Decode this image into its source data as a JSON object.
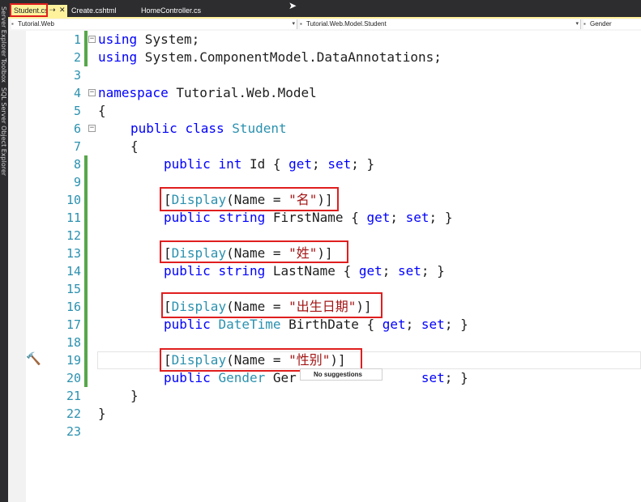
{
  "tabs": [
    {
      "label": "Student.cs",
      "active": true
    },
    {
      "label": "Create.cshtml",
      "active": false
    },
    {
      "label": "HomeController.cs",
      "active": false
    }
  ],
  "tab_icons": {
    "pin": "⇢",
    "close": "✕"
  },
  "rail": {
    "items": [
      "Server Explorer",
      "Toolbox",
      "SQL Server Object Explorer"
    ]
  },
  "nav": {
    "project": "Tutorial.Web",
    "type": "Tutorial.Web.Model.Student",
    "member": "Gender"
  },
  "code_lines": [
    {
      "n": "1"
    },
    {
      "n": "2"
    },
    {
      "n": "3"
    },
    {
      "n": "4"
    },
    {
      "n": "5"
    },
    {
      "n": "6"
    },
    {
      "n": "7"
    },
    {
      "n": "8"
    },
    {
      "n": "9"
    },
    {
      "n": "10"
    },
    {
      "n": "11"
    },
    {
      "n": "12"
    },
    {
      "n": "13"
    },
    {
      "n": "14"
    },
    {
      "n": "15"
    },
    {
      "n": "16"
    },
    {
      "n": "17"
    },
    {
      "n": "18"
    },
    {
      "n": "19"
    },
    {
      "n": "20"
    },
    {
      "n": "21"
    },
    {
      "n": "22"
    },
    {
      "n": "23"
    }
  ],
  "code": {
    "l1": {
      "kw": "using",
      "rest": " System;"
    },
    "l2": {
      "kw": "using",
      "rest": " System.ComponentModel.DataAnnotations;"
    },
    "l4": {
      "kw": "namespace",
      "rest": " Tutorial.Web.Model"
    },
    "l5": "{",
    "l6": {
      "kw1": "public",
      "kw2": "class",
      "type": "Student"
    },
    "l7": "{",
    "l8": {
      "kw1": "public",
      "kw2": "int",
      "rest": " Id { ",
      "get": "get",
      "semi1": "; ",
      "set": "set",
      "end": "; }"
    },
    "l10": {
      "open": "[",
      "attr": "Display",
      "mid": "(Name = ",
      "str": "\"名\"",
      "close": ")]"
    },
    "l11": {
      "kw1": "public",
      "kw2": "string",
      "rest": " FirstName { ",
      "get": "get",
      "semi1": "; ",
      "set": "set",
      "end": "; }"
    },
    "l13": {
      "open": "[",
      "attr": "Display",
      "mid": "(Name = ",
      "str": "\"姓\"",
      "close": ")]"
    },
    "l14": {
      "kw1": "public",
      "kw2": "string",
      "rest": " LastName { ",
      "get": "get",
      "semi1": "; ",
      "set": "set",
      "end": "; }"
    },
    "l16": {
      "open": "[",
      "attr": "Display",
      "mid": "(Name = ",
      "str": "\"出生日期\"",
      "close": ")]"
    },
    "l17": {
      "kw1": "public",
      "type": "DateTime",
      "rest": " BirthDate { ",
      "get": "get",
      "semi1": "; ",
      "set": "set",
      "end": "; }"
    },
    "l19": {
      "open": "[",
      "attr": "Display",
      "mid": "(Name = ",
      "str": "\"性别\"",
      "close": ")]"
    },
    "l20": {
      "kw1": "public",
      "type": "Gender",
      "rest": " Ger",
      "set": "set",
      "end": "; }"
    },
    "l21": "}",
    "l22": "}"
  },
  "tooltip": {
    "text": "No suggestions"
  },
  "colors": {
    "keyword": "#0000ff",
    "type": "#2b91af",
    "string": "#a31515",
    "highlight": "#e01e1e",
    "changebar": "#57a64a",
    "active_tab": "#fff29d"
  }
}
